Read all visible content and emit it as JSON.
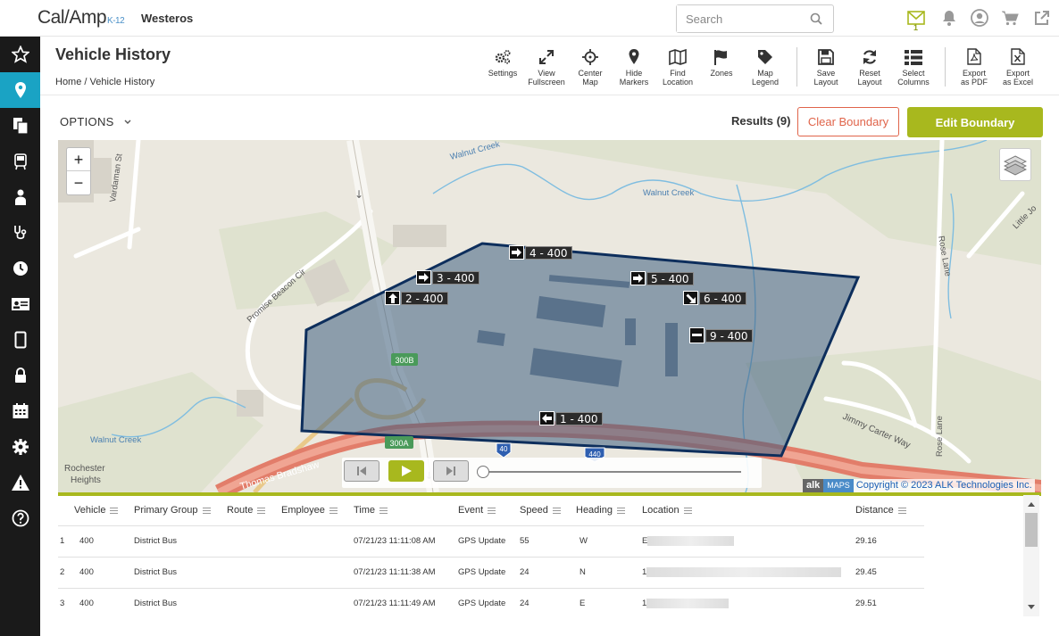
{
  "app": {
    "logo_text": "Cal/Amp",
    "logo_sub": "K-12",
    "org": "Westeros",
    "search_placeholder": "Search",
    "message_count": "1"
  },
  "sidebar": {
    "items": [
      "favorites",
      "map",
      "reports",
      "bus",
      "student",
      "health",
      "history",
      "id-card",
      "tablet",
      "lock",
      "calendar",
      "settings",
      "alerts",
      "help"
    ],
    "active": "map"
  },
  "header": {
    "title": "Vehicle History",
    "breadcrumb_home": "Home",
    "breadcrumb_sep": "/",
    "breadcrumb_current": "Vehicle History"
  },
  "toolbar": [
    {
      "label1": "Settings",
      "label2": "",
      "icon": "gears-icon"
    },
    {
      "label1": "View",
      "label2": "Fullscreen",
      "icon": "expand-icon"
    },
    {
      "label1": "Center",
      "label2": "Map",
      "icon": "crosshair-icon"
    },
    {
      "label1": "Hide",
      "label2": "Markers",
      "icon": "map-marker-icon"
    },
    {
      "label1": "Find",
      "label2": "Location",
      "icon": "folded-map-icon"
    },
    {
      "label1": "Zones",
      "label2": "",
      "icon": "flag-icon"
    },
    {
      "label1": "Map",
      "label2": "Legend",
      "icon": "tag-icon"
    },
    {
      "label1": "Save",
      "label2": "Layout",
      "icon": "floppy-icon"
    },
    {
      "label1": "Reset",
      "label2": "Layout",
      "icon": "refresh-icon"
    },
    {
      "label1": "Select",
      "label2": "Columns",
      "icon": "list-icon"
    },
    {
      "label1": "Export",
      "label2": "as PDF",
      "icon": "pdf-icon"
    },
    {
      "label1": "Export",
      "label2": "as Excel",
      "icon": "excel-icon"
    }
  ],
  "options_label": "OPTIONS",
  "results_label": "Results",
  "results_count": "(9)",
  "clear_boundary": "Clear Boundary",
  "edit_boundary": "Edit Boundary",
  "map": {
    "zoom_in": "+",
    "zoom_out": "−",
    "labels": {
      "vardaman": "Vardaman St",
      "walnut1": "Walnut Creek",
      "walnut2": "Walnut Creek",
      "walnut3": "Walnut Creek",
      "promise": "Promise Beacon Cir",
      "rose": "Rose Lane",
      "rose2": "Rose Lane",
      "little": "Little Jo",
      "jimmy": "Jimmy Carter Way",
      "rochester1": "Rochester",
      "rochester2": "Heights",
      "thomas": "Thomas Bradshaw",
      "exit300b": "300B",
      "exit300a": "300A",
      "i40": "40",
      "i440": "440"
    },
    "markers": [
      {
        "label": "1 - 400",
        "dir": "W"
      },
      {
        "label": "2 - 400",
        "dir": "N"
      },
      {
        "label": "3 - 400",
        "dir": "E"
      },
      {
        "label": "4 - 400",
        "dir": "E"
      },
      {
        "label": "5 - 400",
        "dir": "E"
      },
      {
        "label": "6 - 400",
        "dir": "SE"
      },
      {
        "label": "9 - 400",
        "dir": "stop"
      }
    ],
    "attribution_alk": "alk",
    "attribution_maps": "MAPS",
    "attribution_copy": "Copyright © 2023 ALK Technologies Inc."
  },
  "table": {
    "columns": [
      "Vehicle",
      "Primary Group",
      "Route",
      "Employee",
      "Time",
      "Event",
      "Speed",
      "Heading",
      "Location",
      "Distance"
    ],
    "rows": [
      {
        "n": "1",
        "vehicle": "400",
        "group": "District Bus",
        "route": "",
        "employee": "",
        "time": "07/21/23 11:11:08 AM",
        "event": "GPS Update",
        "speed": "55",
        "heading": "W",
        "location": "E",
        "distance": "29.16"
      },
      {
        "n": "2",
        "vehicle": "400",
        "group": "District Bus",
        "route": "",
        "employee": "",
        "time": "07/21/23 11:11:38 AM",
        "event": "GPS Update",
        "speed": "24",
        "heading": "N",
        "location": "1",
        "distance": "29.45"
      },
      {
        "n": "3",
        "vehicle": "400",
        "group": "District Bus",
        "route": "",
        "employee": "",
        "time": "07/21/23 11:11:49 AM",
        "event": "GPS Update",
        "speed": "24",
        "heading": "E",
        "location": "1",
        "distance": "29.51"
      }
    ]
  },
  "colors": {
    "accent": "#a8b81e",
    "sidebar_active": "#1aa3c4",
    "clear_border": "#e0644a",
    "boundary_stroke": "#0d2e5c",
    "boundary_fill": "#3e5f80"
  }
}
